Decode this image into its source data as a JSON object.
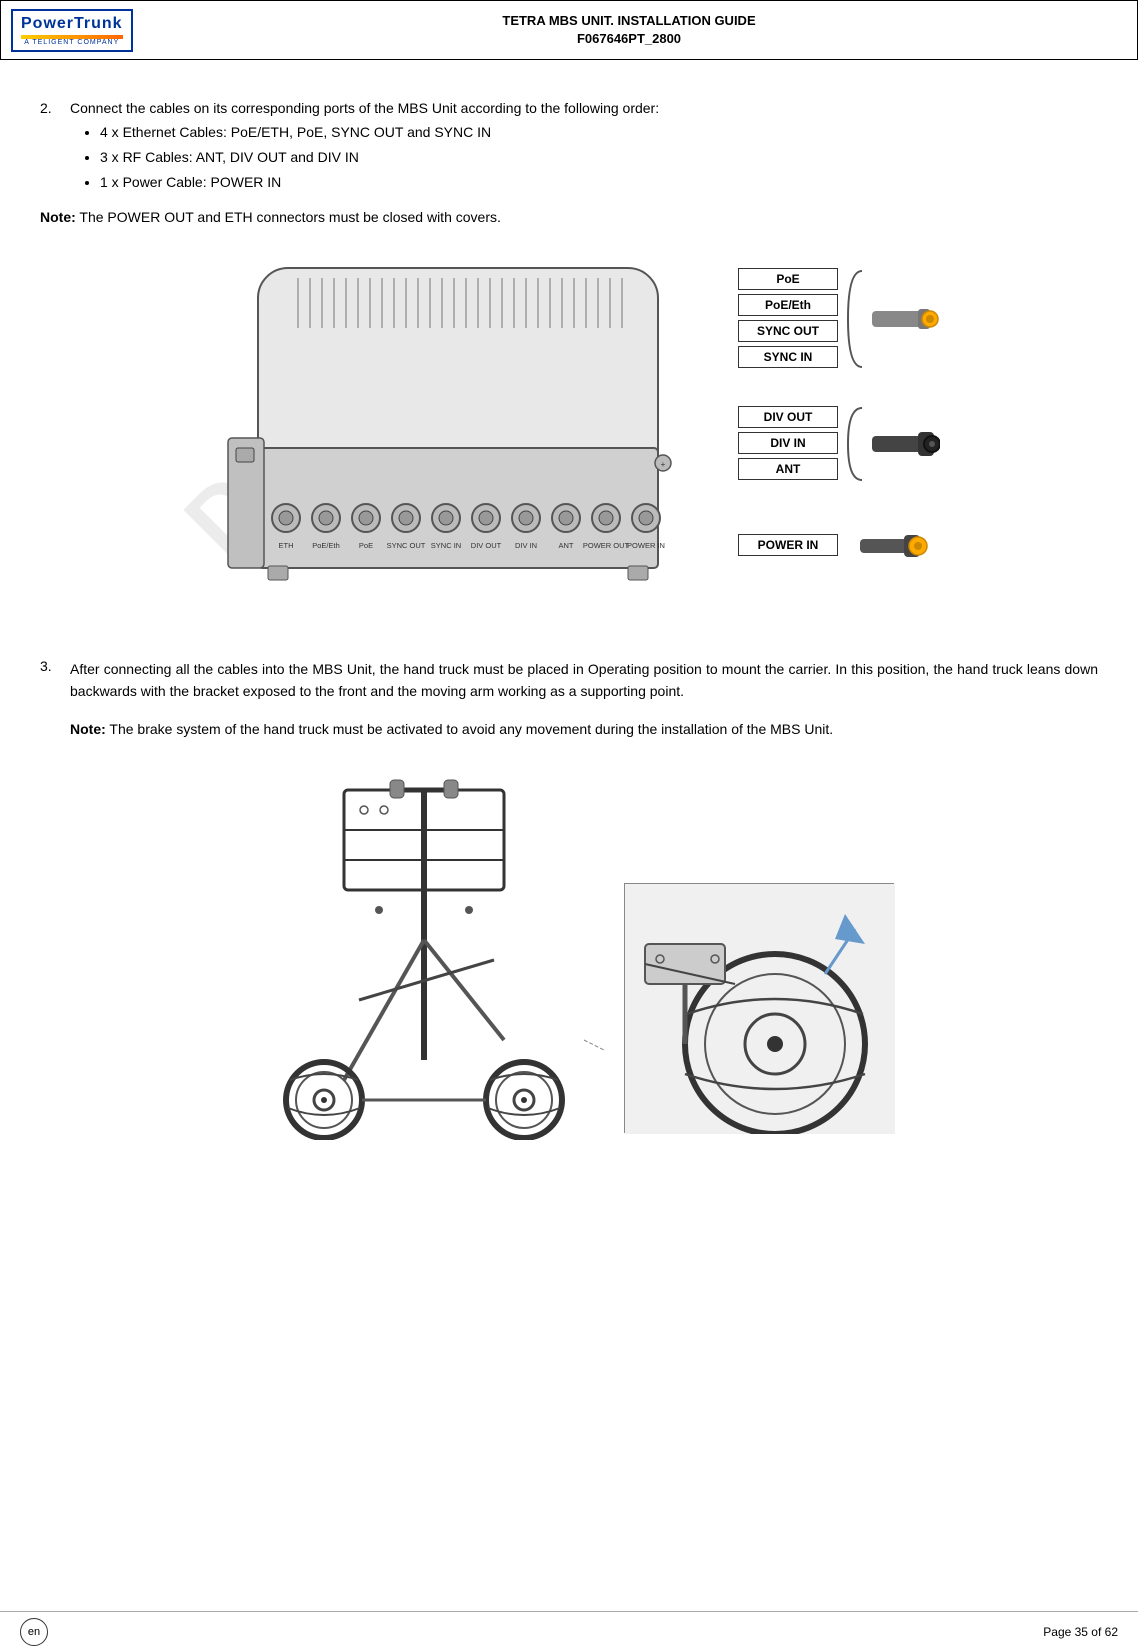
{
  "header": {
    "title_line1": "TETRA MBS UNIT. INSTALLATION GUIDE",
    "title_line2": "F067646PT_2800",
    "logo_main": "PowerTrunk",
    "logo_sub": "A TELIGENT COMPANY"
  },
  "step2": {
    "number": "2.",
    "text": "Connect the cables on its corresponding ports of the MBS Unit according to the following order:",
    "bullets": [
      "4 x Ethernet Cables: PoE/ETH, PoE, SYNC OUT and SYNC IN",
      "3 x RF Cables: ANT, DIV OUT and DIV IN",
      "1 x Power Cable: POWER IN"
    ]
  },
  "note1": {
    "label": "Note:",
    "text": " The POWER OUT and ETH connectors must be closed with covers."
  },
  "labels": {
    "group1": [
      "PoE",
      "PoE/Eth",
      "SYNC OUT",
      "SYNC IN"
    ],
    "group2": [
      "DIV OUT",
      "DIV IN",
      "ANT"
    ],
    "group3": [
      "POWER IN"
    ]
  },
  "mbs_ports": [
    "ETH",
    "PoE/Eth",
    "PoE",
    "SYNC OUT",
    "SYNC IN",
    "DIV OUT",
    "DIV IN",
    "ANT",
    "POWER OUT",
    "POWER IN"
  ],
  "step3": {
    "number": "3.",
    "text": "After connecting all the cables into the MBS Unit, the hand truck must be placed in Operating position to mount the carrier. In this position, the hand truck leans down backwards with the bracket exposed to the front and the moving arm working as a supporting point."
  },
  "note2": {
    "label": "Note:",
    "text": " The brake system of the hand truck must be activated to avoid any movement during the installation of the MBS Unit."
  },
  "footer": {
    "lang": "en",
    "page": "Page 35 of 62"
  },
  "draft_text": "DRAFT"
}
